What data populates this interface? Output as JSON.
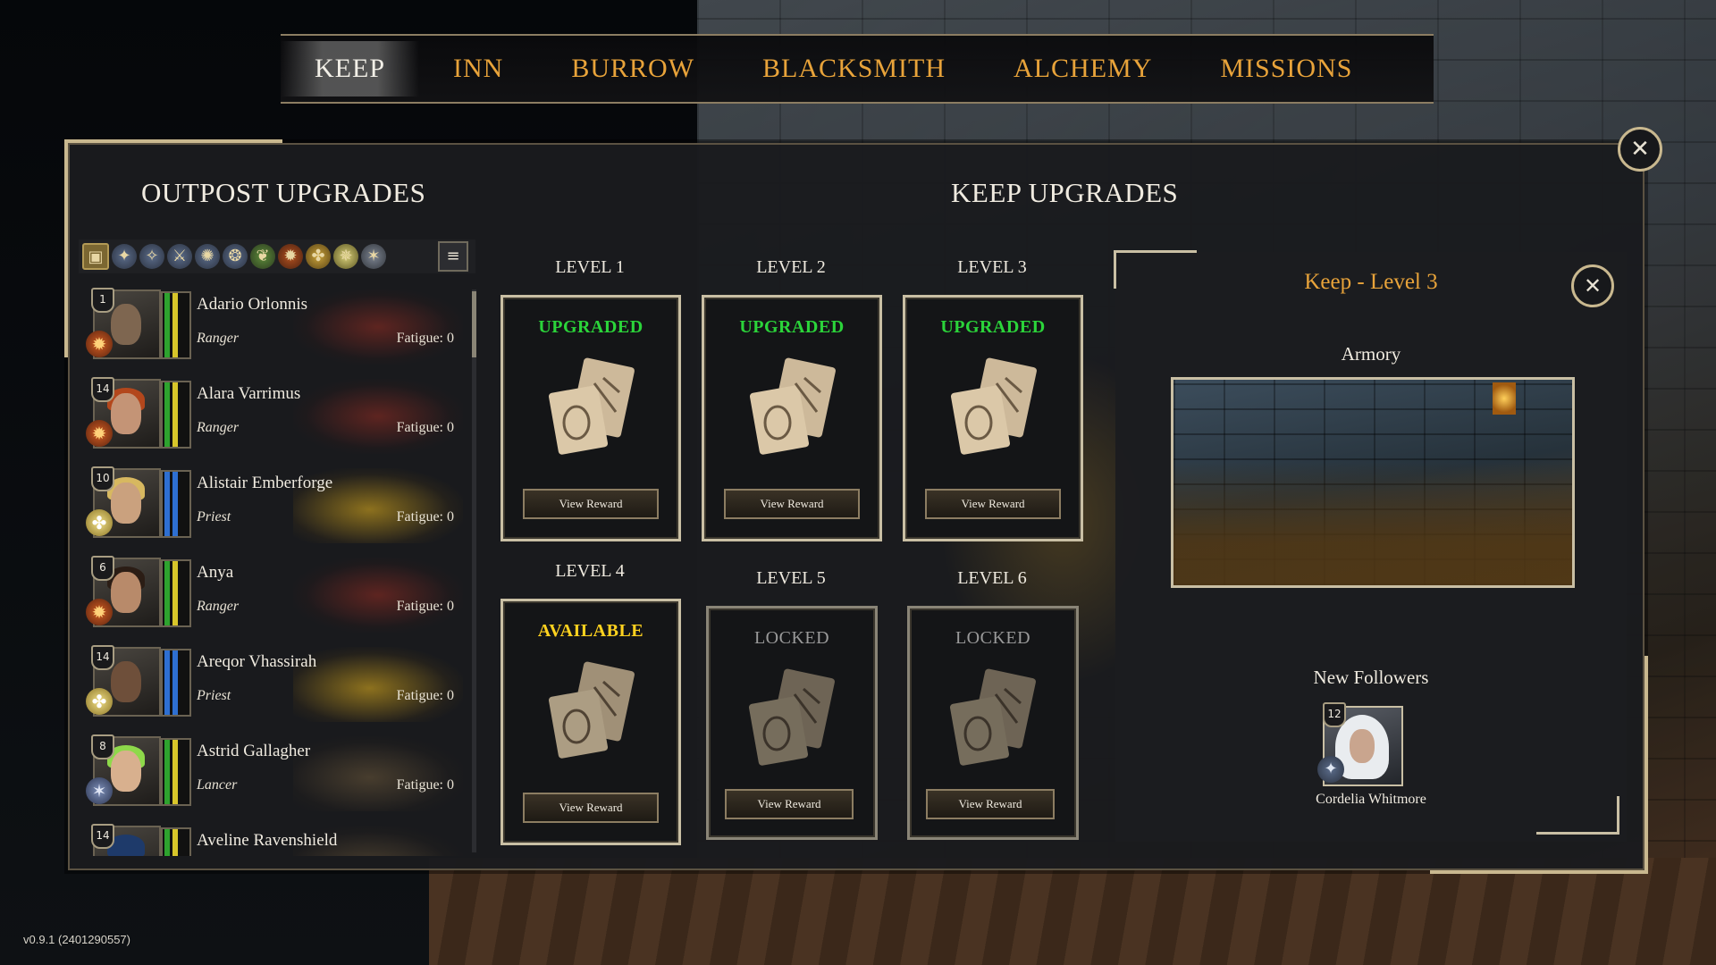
{
  "nav": {
    "tabs": [
      {
        "label": "KEEP",
        "active": true
      },
      {
        "label": "INN"
      },
      {
        "label": "BURROW"
      },
      {
        "label": "BLACKSMITH"
      },
      {
        "label": "ALCHEMY"
      },
      {
        "label": "MISSIONS"
      }
    ]
  },
  "outpost": {
    "title": "OUTPOST UPGRADES",
    "filter_icons": [
      "all-filter-icon",
      "mage-icon",
      "knight-icon",
      "paladin-icon",
      "monk-icon",
      "witch-icon",
      "druid-icon",
      "ranger-icon",
      "priest-icon",
      "cleric-icon",
      "lancer-icon"
    ],
    "followers": [
      {
        "level": "1",
        "name": "Adario Orlonnis",
        "class": "Ranger",
        "fatigue": "Fatigue: 0",
        "badge": "ranger-icon"
      },
      {
        "level": "14",
        "name": "Alara Varrimus",
        "class": "Ranger",
        "fatigue": "Fatigue: 0",
        "badge": "ranger-icon"
      },
      {
        "level": "10",
        "name": "Alistair Emberforge",
        "class": "Priest",
        "fatigue": "Fatigue: 0",
        "badge": "priest-icon"
      },
      {
        "level": "6",
        "name": "Anya",
        "class": "Ranger",
        "fatigue": "Fatigue: 0",
        "badge": "ranger-icon"
      },
      {
        "level": "14",
        "name": "Areqor Vhassirah",
        "class": "Priest",
        "fatigue": "Fatigue: 0",
        "badge": "priest-icon"
      },
      {
        "level": "8",
        "name": "Astrid Gallagher",
        "class": "Lancer",
        "fatigue": "Fatigue: 0",
        "badge": "lancer-icon"
      },
      {
        "level": "14",
        "name": "Aveline Ravenshield",
        "class": "",
        "fatigue": "",
        "badge": "mage-icon"
      }
    ]
  },
  "keep": {
    "title": "KEEP UPGRADES",
    "levels": [
      {
        "title": "LEVEL 1",
        "status": "UPGRADED",
        "button": "View Reward"
      },
      {
        "title": "LEVEL 2",
        "status": "UPGRADED",
        "button": "View Reward"
      },
      {
        "title": "LEVEL 3",
        "status": "UPGRADED",
        "button": "View Reward"
      },
      {
        "title": "LEVEL 4",
        "status": "AVAILABLE",
        "button": "View Reward"
      },
      {
        "title": "LEVEL 5",
        "status": "LOCKED",
        "button": "View Reward"
      },
      {
        "title": "LEVEL 6",
        "status": "LOCKED",
        "button": "View Reward"
      }
    ],
    "colors": {
      "upgraded": "#2bd43a",
      "available": "#ffd21f",
      "locked": "#9a9a9a"
    }
  },
  "detail": {
    "title": "Keep - Level 3",
    "reward_label": "Armory",
    "followers_label": "New Followers",
    "new_follower": {
      "level": "12",
      "name": "Cordelia Whitmore",
      "badge": "mage-icon"
    }
  },
  "version": "v0.9.1 (2401290557)"
}
